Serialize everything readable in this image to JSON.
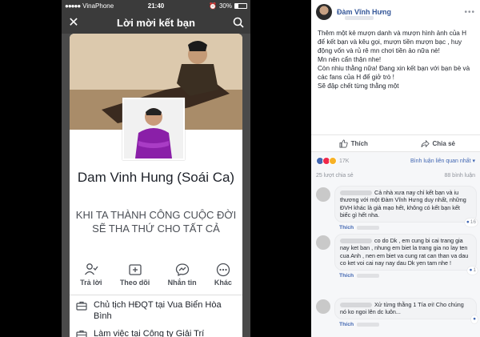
{
  "phone": {
    "carrier": "VinaPhone",
    "time": "21:40",
    "battery_text": "30%",
    "nav_title": "Lời mời kết bạn",
    "profile_name": "Dam Vinh Hung (Soái Ca)",
    "slogan": "KHI TA THÀNH CÔNG CUỘC ĐỜI SẼ THA THỨ CHO TẤT CẢ",
    "actions": [
      {
        "label": "Trả lời",
        "icon": "person-check-icon"
      },
      {
        "label": "Theo dõi",
        "icon": "follow-icon"
      },
      {
        "label": "Nhắn tin",
        "icon": "messenger-icon"
      },
      {
        "label": "Khác",
        "icon": "more-icon"
      }
    ],
    "info": [
      "Chủ tịch HĐQT tại Vua Biển Hòa Bình",
      "Làm việc tại Công ty Giải Trí"
    ]
  },
  "post": {
    "author": "Đàm Vĩnh Hưng",
    "text_lines": [
      "Thêm một kẻ mượn danh và mượn hình ảnh của H để kết bạn và kêu gọi, mượn tiền mượn bạc , huy động vốn và rủ rê mn chơi tiền ảo nữa nè!",
      "Mn nên cẩn thận nhe!",
      "Còn nhiu thằng nữa! Đang xin kết bạn với bạn bè và các fans của H để giở trò !",
      "Sẽ đập chết từng thằng một"
    ],
    "like_label": "Thích",
    "share_label": "Chia sẻ",
    "reactions_count": "17K",
    "sort_label": "Bình luận liên quan nhất",
    "shares_count": "25 lượt chia sẻ",
    "comments_count": "88 bình luận",
    "comments": [
      {
        "text": "Cả nhà xưa nay chỉ kết bạn và iu thương với một Đàm Vĩnh Hưng duy nhất, những ĐVH khác là giả mạo hết, không có kết bạn kết biếc gì hết nha.",
        "likes": "16",
        "action": "Thích"
      },
      {
        "text": "co do Dk , em cung bi cai trang gia nay ket ban , nhung em biet la trang gia no lay ten cua Anh , nen em biet va cung rat can than va dau co ket voi cai nay nay dau Dk yen tam nhe !",
        "likes": "1",
        "action": "Thích"
      },
      {
        "text": "Xử từng thằng 1 Tía ơi! Cho chúng nó ko ngoi lên dc luôn...",
        "likes": "",
        "action": "Thích"
      }
    ]
  }
}
